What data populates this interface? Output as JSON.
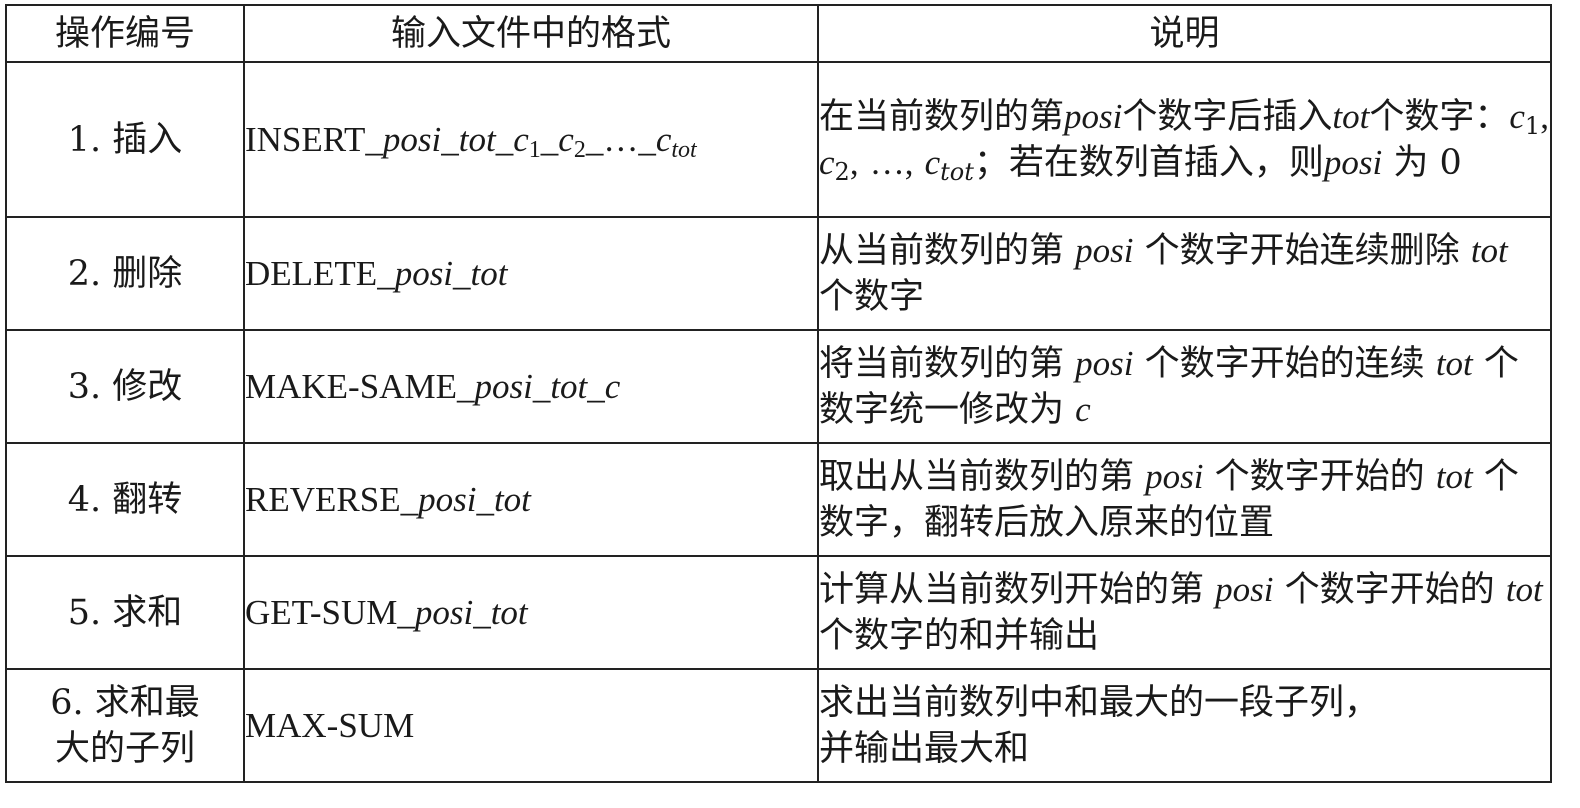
{
  "header": {
    "col1": "操作编号",
    "col2": "输入文件中的格式",
    "col3": "说明"
  },
  "rows": [
    {
      "num": "1. 插入",
      "fmt": {
        "cmd": "INSERT",
        "sep": "_",
        "posi": "posi",
        "tot": "tot",
        "c": "c",
        "sub1": "1",
        "sub2": "2",
        "ellipsis": "…",
        "subtot": "tot"
      },
      "desc": {
        "p1": "在当前数列的第",
        "posi": "posi",
        "p2": "个数字后插入",
        "tot": "tot",
        "p3": "个数字：",
        "c": "c",
        "sub1": "1",
        "comma": ",",
        "sub2": "2",
        "ellipsis": "…",
        "subtot": "tot",
        "p4": "；若在数列首插入，则",
        "posi2": "posi",
        "p5": "为 0"
      }
    },
    {
      "num": "2. 删除",
      "fmt": {
        "cmd": "DELETE",
        "sep": "_",
        "posi": "posi",
        "tot": "tot"
      },
      "desc": {
        "p1": "从当前数列的第",
        "posi": "posi",
        "p2": "个数字开始连续删除",
        "tot": "tot",
        "p3": "个数字"
      }
    },
    {
      "num": "3. 修改",
      "fmt": {
        "cmd": "MAKE-SAME",
        "sep": "_",
        "posi": "posi",
        "tot": "tot",
        "c": "c"
      },
      "desc": {
        "p1": "将当前数列的第",
        "posi": "posi",
        "p2": "个数字开始的连续",
        "tot": "tot",
        "p3": "个数字统一修改为",
        "c": "c"
      }
    },
    {
      "num": "4. 翻转",
      "fmt": {
        "cmd": "REVERSE",
        "sep": "_",
        "posi": "posi",
        "tot": "tot"
      },
      "desc": {
        "p1": "取出从当前数列的第",
        "posi": "posi",
        "p2": "个数字开始的",
        "tot": "tot",
        "p3": "个数字，翻转后放入原来的位置"
      }
    },
    {
      "num": "5. 求和",
      "fmt": {
        "cmd": "GET-SUM",
        "sep": "_",
        "posi": "posi",
        "tot": "tot"
      },
      "desc": {
        "p1": "计算从当前数列开始的第",
        "posi": "posi",
        "p2": "个数字开始的",
        "tot": "tot",
        "p3": "个数字的和并输出"
      }
    },
    {
      "num_line1": "6. 求和最",
      "num_line2": "大的子列",
      "fmt": {
        "cmd": "MAX-SUM"
      },
      "desc": {
        "line1": "求出当前数列中和最大的一段子列，",
        "line2": "并输出最大和"
      }
    }
  ]
}
